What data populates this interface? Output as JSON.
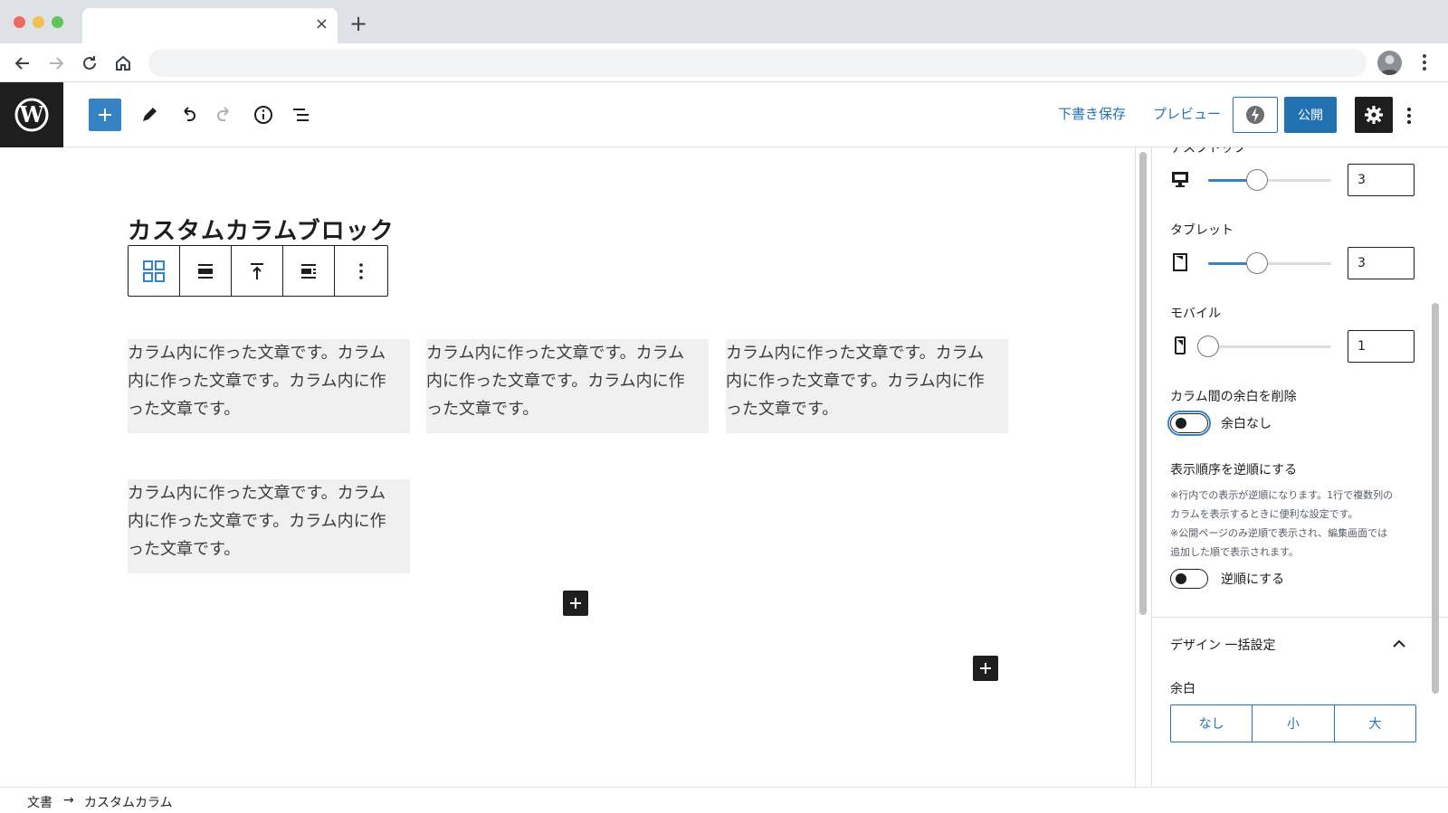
{
  "browser": {
    "tab_close": "×",
    "new_tab": "+"
  },
  "header": {
    "save_draft": "下書き保存",
    "preview": "プレビュー",
    "publish": "公開"
  },
  "canvas": {
    "block_title": "カスタムカラムブロック",
    "columns": [
      {
        "lines": [
          "カラム内に作った文章です。カラム",
          "内に作った文章です。カラム内に作",
          "った文章です。"
        ]
      },
      {
        "lines": [
          "カラム内に作った文章です。カラム",
          "内に作った文章です。カラム内に作",
          "った文章です。"
        ]
      },
      {
        "lines": [
          "カラム内に作った文章です。カラム",
          "内に作った文章です。カラム内に作",
          "った文章です。"
        ]
      },
      {
        "lines": [
          "カラム内に作った文章です。カラム",
          "内に作った文章です。カラム内に作",
          "った文章です。"
        ]
      }
    ]
  },
  "sidebar": {
    "desktop_label": "デスクトップ",
    "desktop_value": "3",
    "desktop_fraction": 0.4,
    "tablet_label": "タブレット",
    "tablet_value": "3",
    "tablet_fraction": 0.4,
    "mobile_label": "モバイル",
    "mobile_value": "1",
    "mobile_fraction": 0.0,
    "gap_heading": "カラム間の余白を削除",
    "gap_toggle_label": "余白なし",
    "reverse_heading": "表示順序を逆順にする",
    "reverse_note_lines": [
      "※行内での表示が逆順になります。1行で複数列の",
      "カラムを表示するときに便利な設定です。",
      "※公開ページのみ逆順で表示され、編集画面では",
      "追加した順で表示されます。"
    ],
    "reverse_toggle_label": "逆順にする",
    "design_panel_title": "デザイン 一括設定",
    "margin_label": "余白",
    "margin_options": [
      "なし",
      "小",
      "大"
    ]
  },
  "footer": {
    "crumbs": [
      "文書",
      "カスタムカラム"
    ],
    "separator": "→"
  },
  "colors": {
    "accent": "#2271b1",
    "add_button": "#3582c4",
    "dark": "#1e1e1e",
    "column_bg": "#f0f0f1"
  }
}
